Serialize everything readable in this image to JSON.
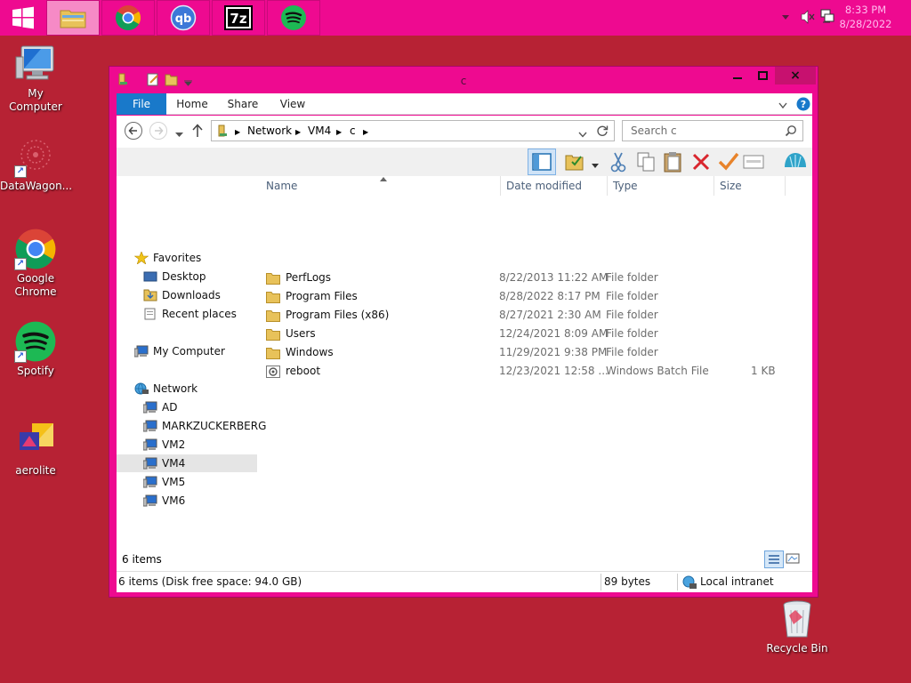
{
  "taskbar": {
    "apps": [
      {
        "name": "File Explorer",
        "icon": "file-explorer-icon",
        "active": true
      },
      {
        "name": "Google Chrome",
        "icon": "chrome-icon",
        "active": false
      },
      {
        "name": "qBittorrent",
        "icon": "qbittorrent-icon",
        "label": "qb",
        "active": false
      },
      {
        "name": "7-Zip",
        "icon": "7zip-icon",
        "label": "7z",
        "active": false
      },
      {
        "name": "Spotify",
        "icon": "spotify-icon",
        "active": false
      }
    ],
    "clock": {
      "time": "8:33 PM",
      "date": "8/28/2022"
    },
    "tray_icons": [
      "tray-expand-icon",
      "volume-muted-icon",
      "network-icon"
    ]
  },
  "desktop": {
    "icons": [
      {
        "label": "My Computer",
        "icon": "my-computer-icon"
      },
      {
        "label": "DataWagon...",
        "icon": "datawagon-icon"
      },
      {
        "label": "Google Chrome",
        "icon": "chrome-icon"
      },
      {
        "label": "Spotify",
        "icon": "spotify-icon"
      },
      {
        "label": "aerolite",
        "icon": "aerolite-icon"
      },
      {
        "label": "Recycle Bin",
        "icon": "recycle-bin-icon"
      }
    ]
  },
  "window": {
    "title": "c",
    "controls": {
      "minimize": "minimize-icon",
      "maximize": "maximize-icon",
      "close": "×"
    },
    "ribbon_tabs": [
      "File",
      "Home",
      "Share",
      "View"
    ],
    "address": {
      "segments": [
        "Network",
        "VM4",
        "c"
      ]
    },
    "search": {
      "placeholder": "Search c"
    },
    "nav": {
      "favorites_header": "Favorites",
      "favorites": [
        "Desktop",
        "Downloads",
        "Recent places"
      ],
      "computer": "My Computer",
      "network_header": "Network",
      "network": [
        "AD",
        "MARKZUCKERBERG",
        "VM2",
        "VM4",
        "VM5",
        "VM6"
      ],
      "selected": "VM4"
    },
    "columns": [
      "Name",
      "Date modified",
      "Type",
      "Size"
    ],
    "files": [
      {
        "name": "PerfLogs",
        "date": "8/22/2013 11:22 AM",
        "type": "File folder",
        "size": "",
        "icon": "folder-icon"
      },
      {
        "name": "Program Files",
        "date": "8/28/2022 8:17 PM",
        "type": "File folder",
        "size": "",
        "icon": "folder-icon"
      },
      {
        "name": "Program Files (x86)",
        "date": "8/27/2021 2:30 AM",
        "type": "File folder",
        "size": "",
        "icon": "folder-icon"
      },
      {
        "name": "Users",
        "date": "12/24/2021 8:09 AM",
        "type": "File folder",
        "size": "",
        "icon": "folder-icon"
      },
      {
        "name": "Windows",
        "date": "11/29/2021 9:38 PM",
        "type": "File folder",
        "size": "",
        "icon": "folder-icon"
      },
      {
        "name": "reboot",
        "date": "12/23/2021 12:58 ...",
        "type": "Windows Batch File",
        "size": "1 KB",
        "icon": "batch-file-icon"
      }
    ],
    "item_count": "6 items",
    "status": {
      "summary": "6 items (Disk free space: 94.0 GB)",
      "size": "89 bytes",
      "zone": "Local intranet"
    }
  },
  "colors": {
    "desktop": "#b72234",
    "taskbar": "#ee0a90",
    "window_frame": "#ee0a90",
    "file_tab": "#1979ca",
    "folder": "#e8c25a"
  }
}
